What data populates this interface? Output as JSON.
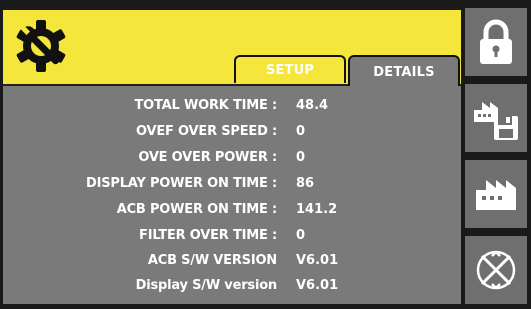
{
  "tabs": {
    "setup": "SETUP",
    "details": "DETAILS"
  },
  "details": [
    {
      "label": "TOTAL WORK TIME :",
      "value": "48.4"
    },
    {
      "label": "OVEF OVER SPEED :",
      "value": "0"
    },
    {
      "label": "OVE OVER POWER :",
      "value": "0"
    },
    {
      "label": "DISPLAY POWER ON TIME :",
      "value": "86"
    },
    {
      "label": "ACB POWER ON TIME :",
      "value": "141.2"
    },
    {
      "label": "FILTER OVER TIME :",
      "value": "0"
    },
    {
      "label": "ACB S/W VERSION",
      "value": "V6.01"
    },
    {
      "label": "Display S/W version",
      "value": "V6.01"
    }
  ],
  "icons": {
    "app": "gear-wrench-icon",
    "lock": "lock-icon",
    "factory_save": "factory-save-icon",
    "factory": "factory-icon",
    "reset": "reset-icon"
  },
  "colors": {
    "header": "#f4e63a",
    "panel": "#7a7a7a",
    "sidebar": "#6f6f6f"
  }
}
